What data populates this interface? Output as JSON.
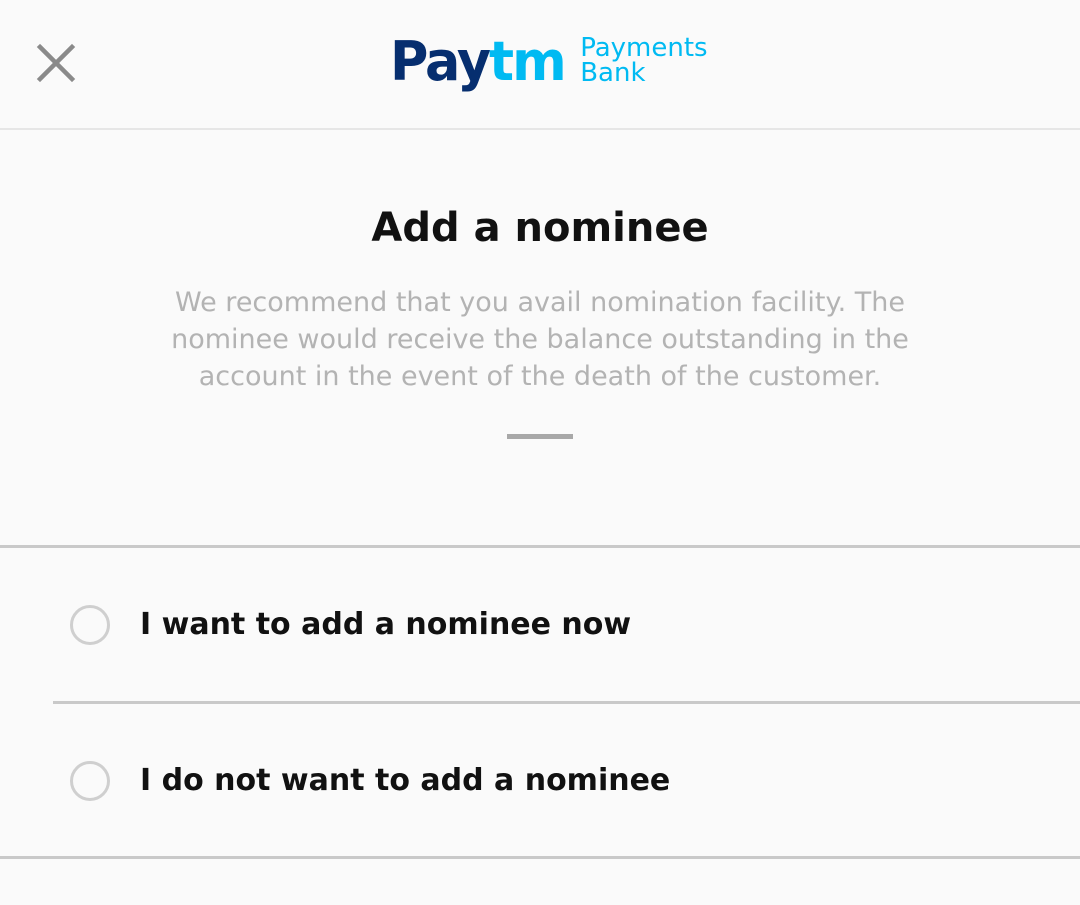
{
  "header": {
    "close_icon": "close-icon",
    "logo": {
      "brand_main": "Pay",
      "brand_accent": "tm",
      "sub_line1": "Payments",
      "sub_line2": "Bank",
      "colors": {
        "navy": "#062e6f",
        "cyan": "#00baf2"
      }
    }
  },
  "main": {
    "title": "Add a nominee",
    "description": "We recommend that you avail nomination facility. The nominee would receive the balance outstanding in the account in the event of the death of the customer."
  },
  "options": [
    {
      "label": "I want to add a nominee now",
      "selected": false
    },
    {
      "label": "I do not want to add a nominee",
      "selected": false
    }
  ]
}
